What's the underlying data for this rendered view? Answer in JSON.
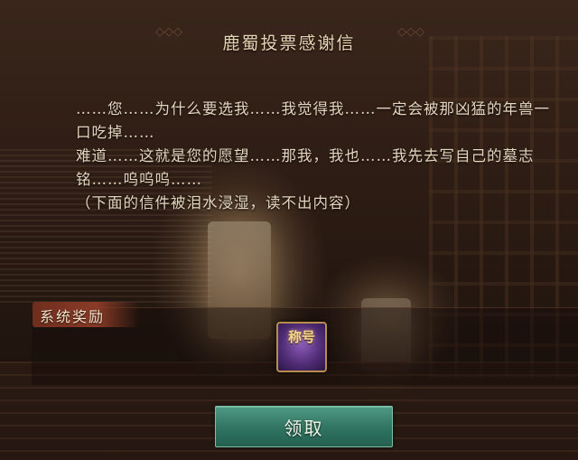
{
  "title": "鹿蜀投票感谢信",
  "letter": {
    "line1": "……您……为什么要选我……我觉得我……一定会被那凶猛的年兽一口吃掉……",
    "line2": "难道……这就是您的愿望……那我，我也……我先去写自己的墓志铭……呜呜呜……",
    "line3": "（下面的信件被泪水浸湿，读不出内容）"
  },
  "rewards": {
    "label": "系统奖励",
    "item_text": "称号",
    "item_icon": "title-badge-icon"
  },
  "claim_button": {
    "label": "领取"
  },
  "colors": {
    "text": "#e4d6bf",
    "accent_button": "#2f7360",
    "reward_label_bg": "#8a3b27",
    "item_frame": "#b88c4c"
  }
}
